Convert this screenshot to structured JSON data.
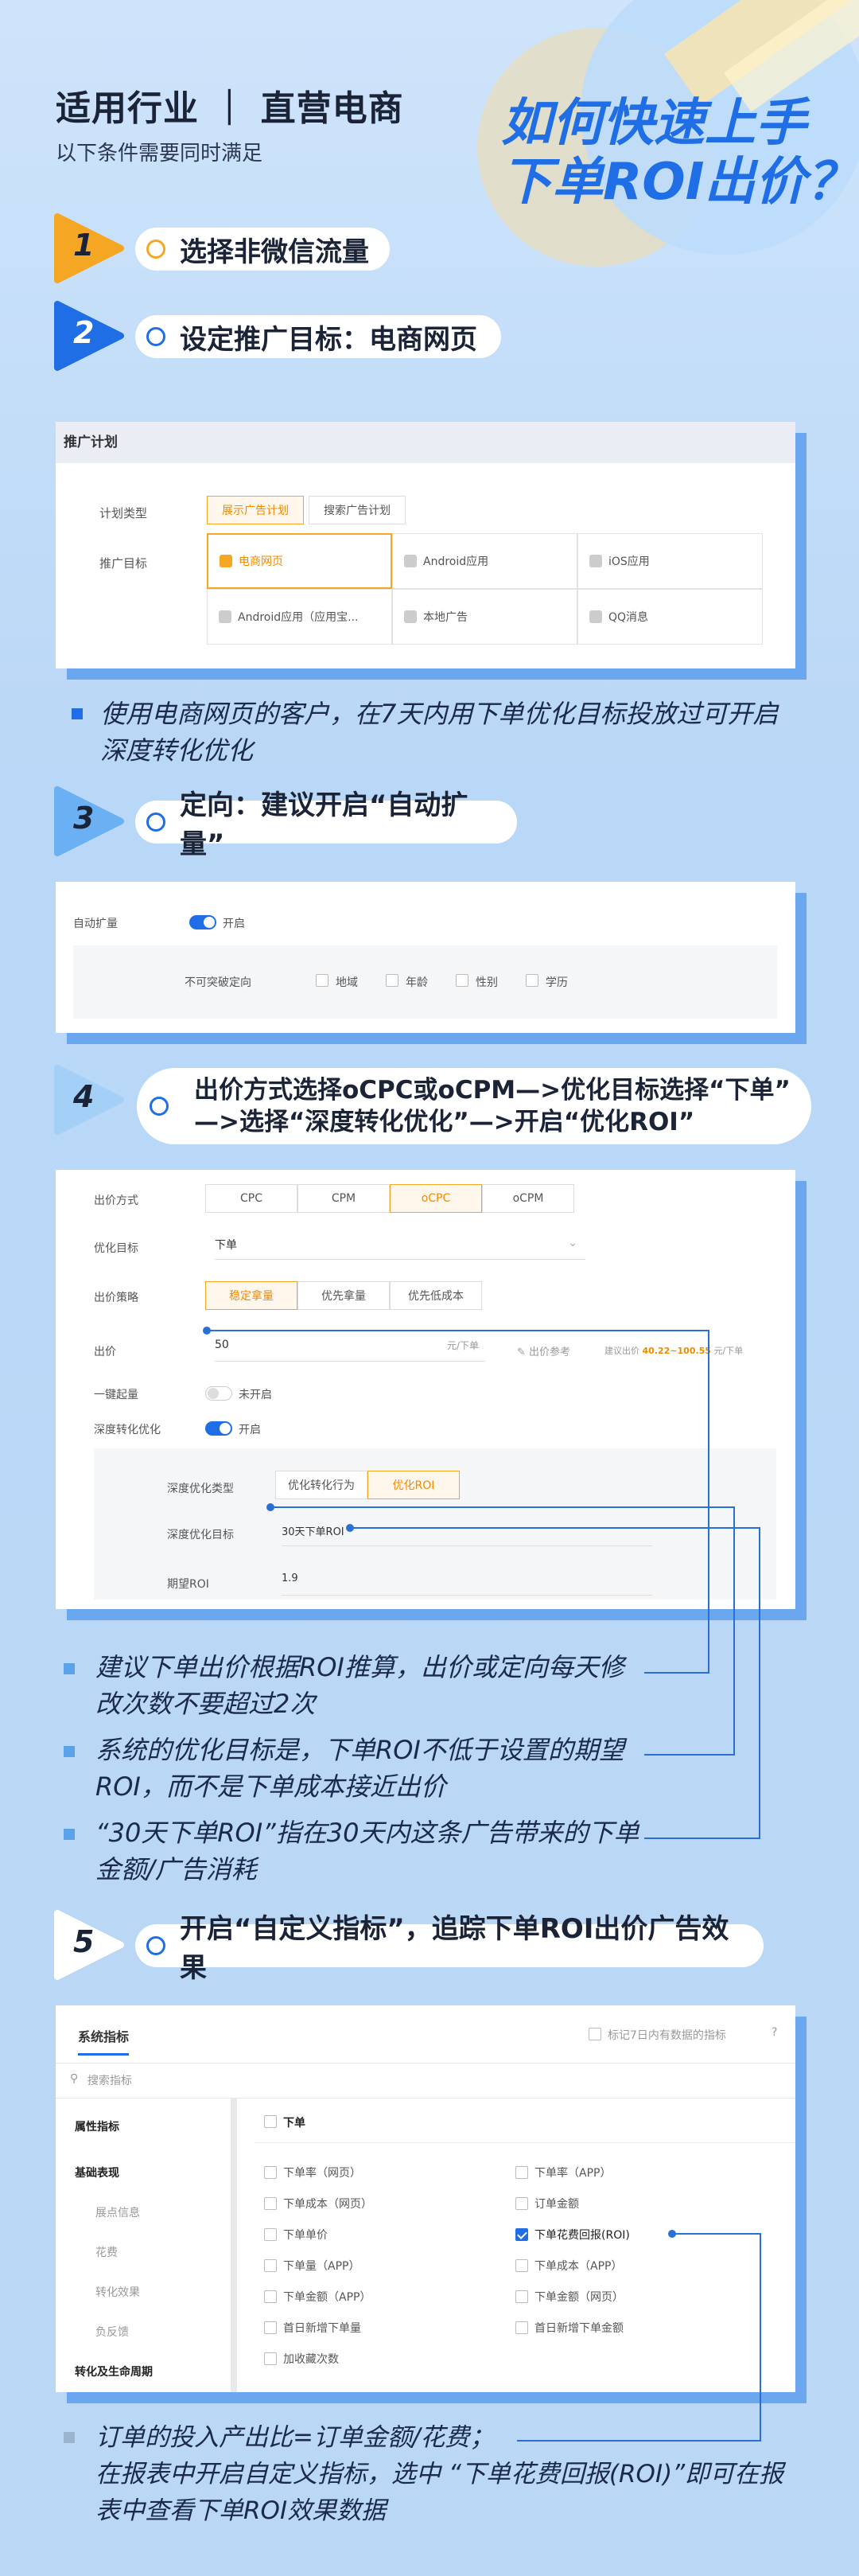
{
  "header": {
    "title": "适用行业 ｜ 直营电商",
    "subtitle": "以下条件需要同时满足",
    "hero_line1": "如何快速上手",
    "hero_line2": "下单ROI出价？"
  },
  "steps": [
    {
      "num": "1",
      "text": "选择非微信流量"
    },
    {
      "num": "2",
      "text": "设定推广目标：电商网页"
    },
    {
      "num": "3",
      "text": "定向：建议开启“自动扩量”"
    },
    {
      "num": "4",
      "text_line1": "出价方式选择oCPC或oCPM—>优化目标选择“下单”",
      "text_line2": "—>选择“深度转化优化”—>开启“优化ROI”"
    },
    {
      "num": "5",
      "text": "开启“自定义指标”，追踪下单ROI出价广告效果"
    }
  ],
  "plan_card": {
    "header": "推广计划",
    "plan_type_label": "计划类型",
    "plan_types": [
      "展示广告计划",
      "搜索广告计划"
    ],
    "goal_label": "推广目标",
    "goals": [
      "电商网页",
      "Android应用",
      "iOS应用",
      "Android应用（应用宝...",
      "本地广告",
      "QQ消息"
    ]
  },
  "note2": "使用电商网页的客户，在7天内用下单优化目标投放过可开启深度转化优化",
  "expand_card": {
    "label": "自动扩量",
    "toggle_text": "开启",
    "sub_label": "不可突破定向",
    "options": [
      "地域",
      "年龄",
      "性别",
      "学历"
    ]
  },
  "bid_card": {
    "method_label": "出价方式",
    "methods": [
      "CPC",
      "CPM",
      "oCPC",
      "oCPM"
    ],
    "goal_label": "优化目标",
    "goal_value": "下单",
    "strategy_label": "出价策略",
    "strategies": [
      "稳定拿量",
      "优先拿量",
      "优先低成本"
    ],
    "price_label": "出价",
    "price_value": "50",
    "price_unit": "元/下单",
    "price_ref": "出价参考",
    "price_suggest_prefix": "建议出价",
    "price_suggest_range": "40.22~100.55",
    "price_suggest_suffix": "元/下单",
    "one_click_label": "一键起量",
    "one_click_value": "未开启",
    "deep_label": "深度转化优化",
    "deep_value": "开启",
    "deep_type_label": "深度优化类型",
    "deep_types": [
      "优化转化行为",
      "优化ROI"
    ],
    "deep_goal_label": "深度优化目标",
    "deep_goal_value": "30天下单ROI",
    "expect_roi_label": "期望ROI",
    "expect_roi_value": "1.9"
  },
  "notes4": [
    "建议下单出价根据ROI推算，出价或定向每天修改次数不要超过2次",
    "系统的优化目标是，下单ROI不低于设置的期望ROI，而不是下单成本接近出价",
    "“30天下单ROI”指在30天内这条广告带来的下单金额/广告消耗"
  ],
  "metrics_card": {
    "tab": "系统指标",
    "mark_label": "标记7日内有数据的指标",
    "search_placeholder": "搜索指标",
    "side": [
      "属性指标",
      "基础表现",
      "展点信息",
      "花费",
      "转化效果",
      "负反馈",
      "转化及生命周期"
    ],
    "group_title": "下单",
    "left_items": [
      "下单率（网页）",
      "下单成本（网页）",
      "下单单价",
      "下单量（APP）",
      "下单金额（APP）",
      "首日新增下单量",
      "加收藏次数"
    ],
    "right_items": [
      "下单率（APP）",
      "订单金额",
      "下单花费回报(ROI)",
      "下单成本（APP）",
      "下单金额（网页）",
      "首日新增下单金额"
    ]
  },
  "note5_line1": "订单的投入产出比=订单金额/花费；",
  "note5_line2": "在报表中开启自定义指标，选中 “下单花费回报(ROI)”即可在报表中查看下单ROI效果数据"
}
